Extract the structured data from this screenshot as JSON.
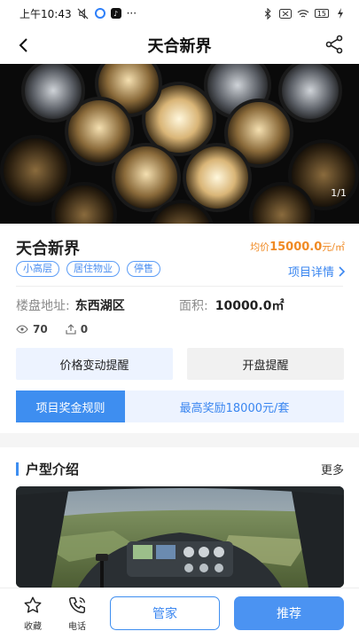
{
  "status_bar": {
    "time": "上午10:43",
    "dots": "···",
    "battery": "15"
  },
  "nav": {
    "title": "天合新界"
  },
  "hero": {
    "counter": "1/1"
  },
  "project": {
    "name": "天合新界",
    "price_prefix": "均价",
    "price_value": "15000.0",
    "price_unit": "元/㎡",
    "tags": [
      "小高层",
      "居住物业",
      "停售"
    ],
    "detail_link": "项目详情",
    "address_label": "楼盘地址:",
    "address_value": "东西湖区",
    "area_label": "面积:",
    "area_value": "10000.0㎡",
    "views": "70",
    "shares": "0"
  },
  "actions": {
    "price_alert": "价格变动提醒",
    "open_alert": "开盘提醒"
  },
  "bonus": {
    "rule_label": "项目奖金规则",
    "reward_text": "最高奖励18000元/套"
  },
  "floorplan_section": {
    "title": "户型介绍",
    "more": "更多"
  },
  "bottom_bar": {
    "favorite": "收藏",
    "phone": "电话",
    "housekeeper": "管家",
    "recommend": "推荐"
  },
  "colors": {
    "accent": "#3e8ef0",
    "price": "#f08a24",
    "light_blue_bg": "#edf3ff"
  }
}
